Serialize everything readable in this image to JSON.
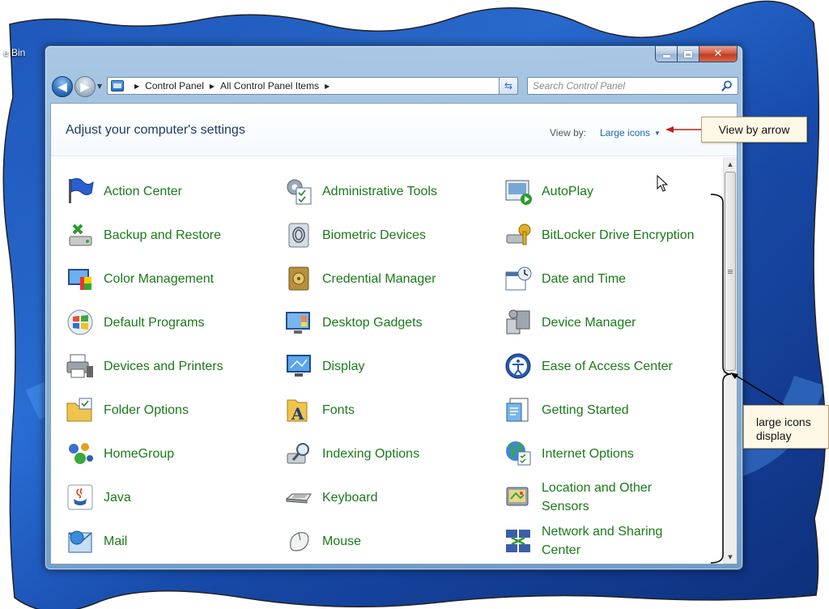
{
  "desktop": {
    "recycle_bin_label": "e Bin"
  },
  "window": {
    "address_crumbs": [
      "Control Panel",
      "All Control Panel Items"
    ],
    "search_placeholder": "Search Control Panel",
    "page_title": "Adjust your computer's settings",
    "view_by_label": "View by:",
    "view_by_value": "Large icons"
  },
  "items": [
    {
      "label": "Action Center",
      "icon": "action-center-flag-icon"
    },
    {
      "label": "Administrative Tools",
      "icon": "administrative-tools-icon"
    },
    {
      "label": "AutoPlay",
      "icon": "autoplay-icon"
    },
    {
      "label": "Backup and Restore",
      "icon": "backup-restore-icon"
    },
    {
      "label": "Biometric Devices",
      "icon": "biometric-fingerprint-icon"
    },
    {
      "label": "BitLocker Drive Encryption",
      "icon": "bitlocker-key-icon"
    },
    {
      "label": "Color Management",
      "icon": "color-management-icon"
    },
    {
      "label": "Credential Manager",
      "icon": "credential-vault-icon"
    },
    {
      "label": "Date and Time",
      "icon": "calendar-clock-icon"
    },
    {
      "label": "Default Programs",
      "icon": "windows-logo-icon"
    },
    {
      "label": "Desktop Gadgets",
      "icon": "desktop-gadgets-icon"
    },
    {
      "label": "Device Manager",
      "icon": "device-manager-icon"
    },
    {
      "label": "Devices and Printers",
      "icon": "printer-icon"
    },
    {
      "label": "Display",
      "icon": "display-monitor-icon"
    },
    {
      "label": "Ease of Access Center",
      "icon": "ease-of-access-icon"
    },
    {
      "label": "Folder Options",
      "icon": "folder-options-icon"
    },
    {
      "label": "Fonts",
      "icon": "fonts-folder-icon"
    },
    {
      "label": "Getting Started",
      "icon": "getting-started-icon"
    },
    {
      "label": "HomeGroup",
      "icon": "homegroup-icon"
    },
    {
      "label": "Indexing Options",
      "icon": "indexing-magnifier-icon"
    },
    {
      "label": "Internet Options",
      "icon": "internet-globe-icon"
    },
    {
      "label": "Java",
      "icon": "java-cup-icon"
    },
    {
      "label": "Keyboard",
      "icon": "keyboard-icon"
    },
    {
      "label": "Location and Other Sensors",
      "icon": "location-sensor-icon"
    },
    {
      "label": "Mail",
      "icon": "mail-icon"
    },
    {
      "label": "Mouse",
      "icon": "mouse-icon"
    },
    {
      "label": "Network and Sharing Center",
      "icon": "network-icon"
    }
  ],
  "callouts": {
    "view_by_arrow": "View by arrow",
    "large_icons_display": "large icons display"
  },
  "colors": {
    "item_link": "#1a7a1a",
    "title": "#1e3a66",
    "view_link": "#1f65b6",
    "callout_arrow": "#c0201a",
    "callout_bg": "#fff8e6"
  }
}
